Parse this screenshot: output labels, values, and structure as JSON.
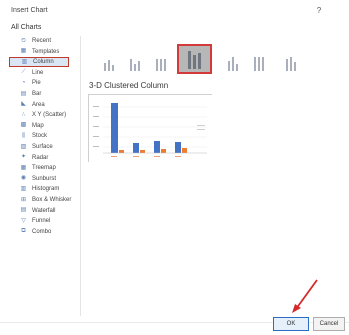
{
  "dialog": {
    "title": "Insert Chart",
    "help": "?"
  },
  "tabs": {
    "all_charts": "All Charts"
  },
  "categories": [
    {
      "label": "Recent",
      "icon": "recent-icon"
    },
    {
      "label": "Templates",
      "icon": "templates-icon"
    },
    {
      "label": "Column",
      "icon": "column-chart-icon",
      "selected": true
    },
    {
      "label": "Line",
      "icon": "line-chart-icon"
    },
    {
      "label": "Pie",
      "icon": "pie-chart-icon"
    },
    {
      "label": "Bar",
      "icon": "bar-chart-icon"
    },
    {
      "label": "Area",
      "icon": "area-chart-icon"
    },
    {
      "label": "X Y (Scatter)",
      "icon": "scatter-chart-icon"
    },
    {
      "label": "Map",
      "icon": "map-chart-icon"
    },
    {
      "label": "Stock",
      "icon": "stock-chart-icon"
    },
    {
      "label": "Surface",
      "icon": "surface-chart-icon"
    },
    {
      "label": "Radar",
      "icon": "radar-chart-icon"
    },
    {
      "label": "Treemap",
      "icon": "treemap-chart-icon"
    },
    {
      "label": "Sunburst",
      "icon": "sunburst-chart-icon"
    },
    {
      "label": "Histogram",
      "icon": "histogram-chart-icon"
    },
    {
      "label": "Box & Whisker",
      "icon": "box-whisker-chart-icon"
    },
    {
      "label": "Waterfall",
      "icon": "waterfall-chart-icon"
    },
    {
      "label": "Funnel",
      "icon": "funnel-chart-icon"
    },
    {
      "label": "Combo",
      "icon": "combo-chart-icon"
    }
  ],
  "subtypes": [
    {
      "name": "clustered-column"
    },
    {
      "name": "stacked-column"
    },
    {
      "name": "100-stacked-column"
    },
    {
      "name": "3d-clustered-column",
      "selected": true
    },
    {
      "name": "3d-stacked-column"
    },
    {
      "name": "3d-100-stacked-column"
    },
    {
      "name": "3d-column"
    }
  ],
  "selected_subtype_title": "3-D Clustered Column",
  "buttons": {
    "ok": "OK",
    "cancel": "Cancel"
  },
  "colors": {
    "accent": "#2b6cc4",
    "highlight": "#d33b3b",
    "series1": "#4472c4",
    "series2": "#ed7d31"
  }
}
